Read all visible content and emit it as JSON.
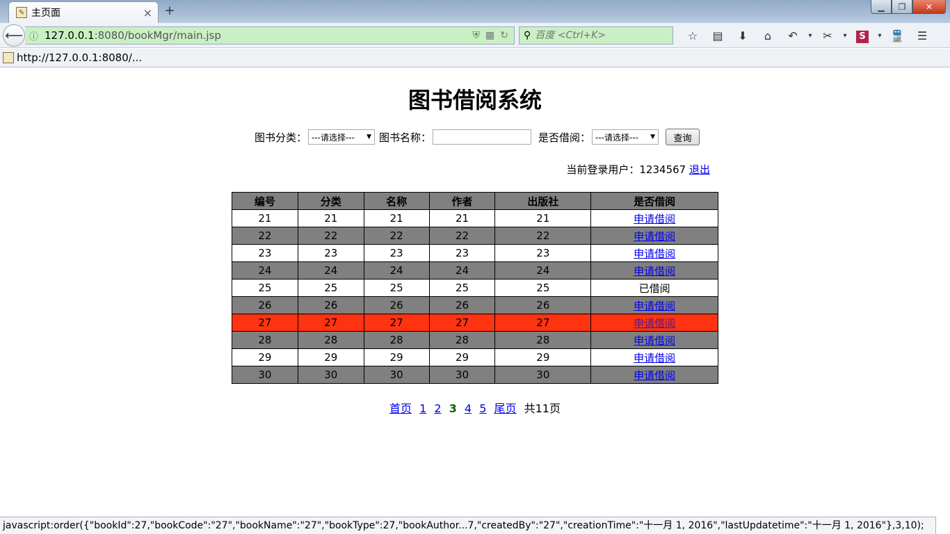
{
  "browser": {
    "tab_title": "主页面",
    "tab_close": "×",
    "new_tab": "+",
    "url_host": "127.0.0.1",
    "url_rest": ":8080/bookMgr/main.jsp",
    "search_placeholder": "百度 <Ctrl+K>",
    "bookmark": "http://127.0.0.1:8080/...",
    "status_text": "javascript:order({\"bookId\":27,\"bookCode\":\"27\",\"bookName\":\"27\",\"bookType\":27,\"bookAuthor...7,\"createdBy\":\"27\",\"creationTime\":\"十一月 1, 2016\",\"lastUpdatetime\":\"十一月 1, 2016\"},3,10);"
  },
  "page": {
    "title": "图书借阅系统",
    "form": {
      "category_label": "图书分类：",
      "category_value": "---请选择---",
      "name_label": "图书名称：",
      "name_value": "",
      "borrowed_label": "是否借阅：",
      "borrowed_value": "---请选择---",
      "query_button": "查询"
    },
    "user": {
      "label": "当前登录用户：1234567",
      "logout": "退出"
    },
    "table": {
      "headers": [
        "编号",
        "分类",
        "名称",
        "作者",
        "出版社",
        "是否借阅"
      ],
      "rows": [
        {
          "id": "21",
          "cat": "21",
          "name": "21",
          "author": "21",
          "pub": "21",
          "status": "申请借阅"
        },
        {
          "id": "22",
          "cat": "22",
          "name": "22",
          "author": "22",
          "pub": "22",
          "status": "申请借阅"
        },
        {
          "id": "23",
          "cat": "23",
          "name": "23",
          "author": "23",
          "pub": "23",
          "status": "申请借阅"
        },
        {
          "id": "24",
          "cat": "24",
          "name": "24",
          "author": "24",
          "pub": "24",
          "status": "申请借阅"
        },
        {
          "id": "25",
          "cat": "25",
          "name": "25",
          "author": "25",
          "pub": "25",
          "status": "已借阅"
        },
        {
          "id": "26",
          "cat": "26",
          "name": "26",
          "author": "26",
          "pub": "26",
          "status": "申请借阅"
        },
        {
          "id": "27",
          "cat": "27",
          "name": "27",
          "author": "27",
          "pub": "27",
          "status": "申请借阅"
        },
        {
          "id": "28",
          "cat": "28",
          "name": "28",
          "author": "28",
          "pub": "28",
          "status": "申请借阅"
        },
        {
          "id": "29",
          "cat": "29",
          "name": "29",
          "author": "29",
          "pub": "29",
          "status": "申请借阅"
        },
        {
          "id": "30",
          "cat": "30",
          "name": "30",
          "author": "30",
          "pub": "30",
          "status": "申请借阅"
        }
      ]
    },
    "pager": {
      "first": "首页",
      "pages": [
        "1",
        "2",
        "3",
        "4",
        "5"
      ],
      "current": "3",
      "last": "尾页",
      "total": "共11页"
    }
  },
  "colors": {
    "row_alt": "#808080",
    "row_highlight": "#fe3311",
    "url_bar": "#c9f0c4",
    "current_page": "#006400"
  }
}
